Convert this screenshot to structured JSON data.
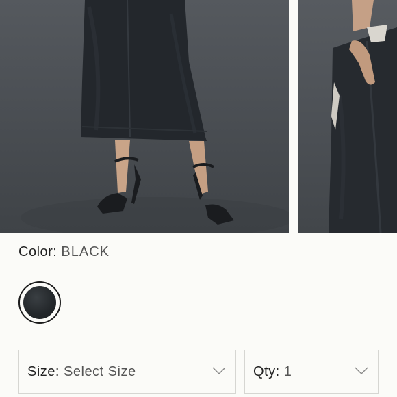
{
  "product": {
    "color": {
      "label": "Color",
      "separator": ":",
      "value": "BLACK",
      "swatch_color": "#23272a"
    },
    "size_select": {
      "label": "Size",
      "separator": ":",
      "value": "Select Size",
      "icon": "chevron-down-icon"
    },
    "qty_select": {
      "label": "Qty",
      "separator": ":",
      "value": "1",
      "icon": "chevron-down-icon"
    }
  },
  "colors": {
    "background": "#fbfbf8",
    "border": "#d6d6d2",
    "text": "#222222",
    "muted_text": "#555555"
  }
}
